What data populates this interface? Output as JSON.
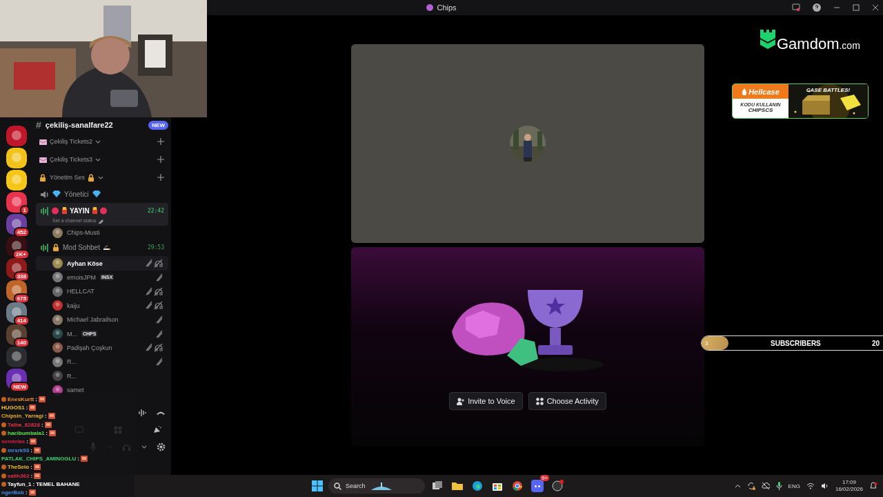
{
  "window": {
    "title": "Chips"
  },
  "servers": [
    {
      "color": "#c0182a"
    },
    {
      "color": "#f2c21b"
    },
    {
      "color": "#f5c518"
    },
    {
      "color": "#e8334f",
      "badge": "1"
    },
    {
      "color": "#6b3fa0",
      "badge": "452"
    },
    {
      "color": "#3a0f12",
      "badge": "2K+"
    },
    {
      "color": "#8f1a1a",
      "badge": "338"
    },
    {
      "color": "#c0652a",
      "badge": "675"
    },
    {
      "color": "#6c7a85",
      "badge": "414"
    },
    {
      "color": "#5a4030",
      "badge": "140"
    },
    {
      "color": "#2b2d31"
    },
    {
      "color": "#6a2fb0",
      "badge": "NEW"
    }
  ],
  "channel_header": {
    "icon": "#",
    "name": "çekiliş-sanalfare22",
    "badge": "NEW"
  },
  "channels": [
    {
      "kind": "category",
      "label": "Çekiliş Tickets2"
    },
    {
      "kind": "category",
      "label": "Çekiliş Tickets3"
    },
    {
      "kind": "category",
      "label": "Yönetim Ses"
    },
    {
      "kind": "voice",
      "label": "Yönetici",
      "selected": false
    },
    {
      "kind": "voice",
      "label": "YAYIN",
      "selected": true,
      "time": "22:42",
      "status": "Set a channel status",
      "members": [
        {
          "name": "Chips-Musti",
          "highlighted": false,
          "muted": false,
          "deafened": false
        }
      ]
    },
    {
      "kind": "voice",
      "label": "Mod Sohbet",
      "selected": false,
      "time": "29:53",
      "members": [
        {
          "name": "Ayhan Köse",
          "highlighted": true,
          "muted": true,
          "deafened": true
        },
        {
          "name": "emoisJPM",
          "tag": "INSX",
          "highlighted": false,
          "muted": true,
          "deafened": false
        },
        {
          "name": "HELLCAT",
          "highlighted": false,
          "muted": true,
          "deafened": true
        },
        {
          "name": "kaiju",
          "highlighted": false,
          "muted": true,
          "deafened": true
        },
        {
          "name": "Michael Jabrailson",
          "highlighted": false,
          "muted": true,
          "deafened": false
        },
        {
          "name": "M...",
          "tag": "CHPS",
          "highlighted": false,
          "muted": true,
          "deafened": false
        },
        {
          "name": "Padişah Çoşkun",
          "highlighted": false,
          "muted": true,
          "deafened": true
        },
        {
          "name": "R...",
          "highlighted": false,
          "muted": true,
          "deafened": false
        },
        {
          "name": "R...",
          "highlighted": false,
          "muted": false,
          "deafened": false
        },
        {
          "name": "samet",
          "highlighted": false,
          "muted": false,
          "deafened": false
        }
      ]
    }
  ],
  "chat": {
    "separator": ":",
    "messages": [
      {
        "user": "EnesKurtt",
        "color": "#f08a24",
        "badge": true
      },
      {
        "user": "HUGOS1",
        "color": "#f2c230",
        "badge": false
      },
      {
        "user": "Chipsin_Yarragi",
        "color": "#e8b020",
        "badge": false
      },
      {
        "user": "Talha_82828",
        "color": "#e0304a",
        "badge": true
      },
      {
        "user": "hacibumbala1",
        "color": "#5ee04a",
        "badge": true
      },
      {
        "user": "semtelas",
        "color": "#d02040",
        "badge": false
      },
      {
        "user": "mrsrk93",
        "color": "#4a8ae8",
        "badge": true
      },
      {
        "user": "PATLAK_CHIPS_AMINOGLU",
        "color": "#38d070",
        "badge": false
      },
      {
        "user": "TheSelo",
        "color": "#f0c020",
        "badge": true
      },
      {
        "user": "salih362",
        "color": "#e0304a",
        "badge": true
      },
      {
        "user": "Tayfun_1",
        "color": "#ffffff",
        "badge": true,
        "text": "TEMEL BAHANE"
      },
      {
        "user": "ngerBob",
        "color": "#4a8ae8",
        "badge": false
      }
    ]
  },
  "activity": {
    "buttons": [
      "Invite to Voice",
      "Choose Activity"
    ]
  },
  "sponsor": {
    "brand": "Gamdom",
    "domain": ".com"
  },
  "banner": {
    "brand": "Hellcase",
    "note": "KODU KULLANIN",
    "code": "CHIPSCS",
    "slogan": "CASE BATTLES!"
  },
  "goal": {
    "count": "3",
    "label": "SUBSCRIBERS",
    "target": "20",
    "level": 0.14
  },
  "taskbar": {
    "search": "Search",
    "notifications": "9+",
    "language": "ENG",
    "time": "17:09",
    "date": "16/02/2026"
  }
}
